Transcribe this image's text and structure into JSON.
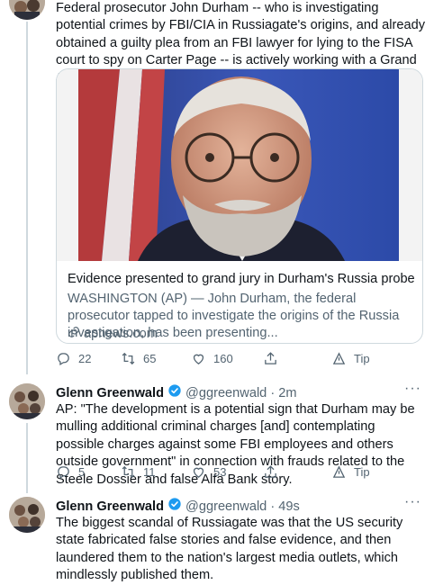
{
  "tweet1": {
    "text": "Federal prosecutor John Durham -- who is investigating potential crimes by FBI/CIA in Russiagate's origins, and already obtained a guilty plea from an FBI lawyer for lying to the FISA court to spy on Carter Page -- is actively working with a Grand Jury:",
    "card": {
      "title": "Evidence presented to grand jury in Durham's Russia probe",
      "description": "WASHINGTON (AP) — John Durham, the federal prosecutor tapped to investigate the origins of the Russia investigation, has been presenting...",
      "domain": "apnews.com"
    },
    "replies": "22",
    "retweets": "65",
    "likes": "160",
    "tip": "Tip"
  },
  "tweet2": {
    "name": "Glenn Greenwald",
    "handle": "@ggreenwald · 2m",
    "text": "AP: \"The development is a potential sign that Durham may be mulling additional criminal charges [and]  contemplating possible charges against some FBI employees and others outside government\" in connection with frauds related to the Steele Dossier and false Alfa Bank story.",
    "replies": "5",
    "retweets": "11",
    "likes": "53",
    "tip": "Tip"
  },
  "tweet3": {
    "name": "Glenn Greenwald",
    "handle": "@ggreenwald · 49s",
    "text": "The biggest scandal of Russiagate was that the US security state fabricated false stories and false evidence, and then laundered them to the nation's largest media outlets, which mindlessly published them."
  },
  "colors": {
    "verified": "#1d9bf0",
    "secondary": "#536471",
    "border": "#cfd9de"
  },
  "icons": [
    "reply-icon",
    "retweet-icon",
    "like-icon",
    "share-icon",
    "tip-icon",
    "verified-badge-icon",
    "link-icon",
    "more-icon"
  ]
}
